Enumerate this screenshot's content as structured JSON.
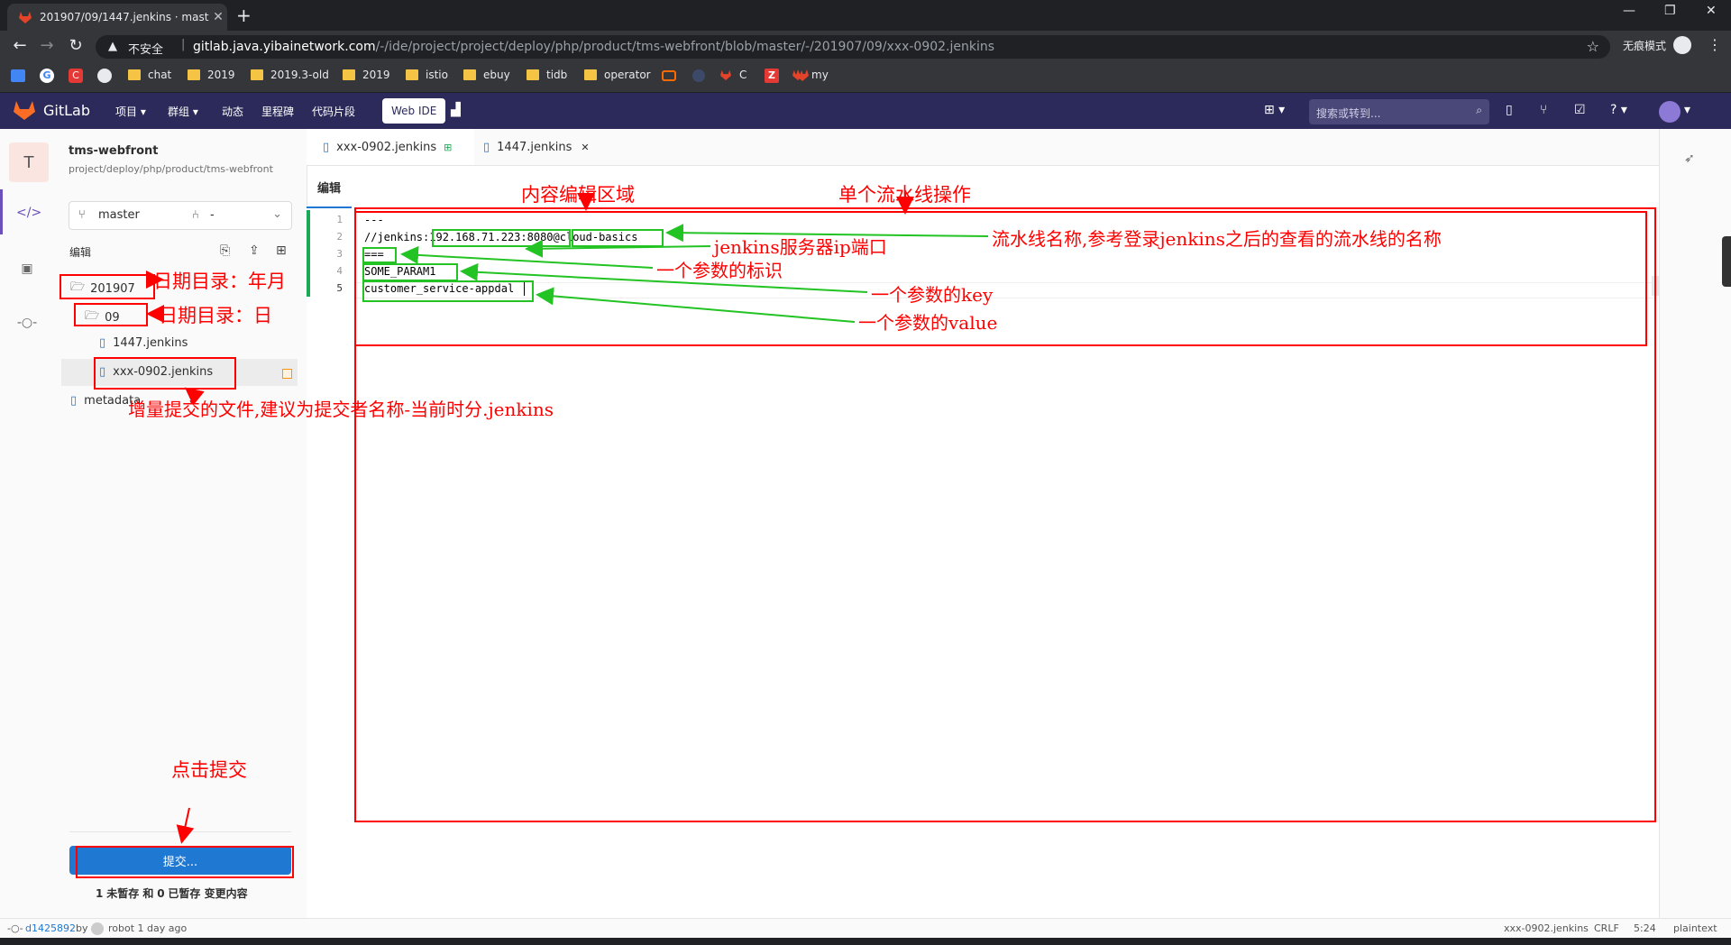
{
  "browser": {
    "tab_title": "201907/09/1447.jenkins · mast",
    "not_secure": "不安全",
    "url_host": "gitlab.java.yibainetwork.com",
    "url_path": "/-/ide/project/project/deploy/php/product/tms-webfront/blob/master/-/201907/09/xxx-0902.jenkins",
    "incognito": "无痕模式",
    "bookmarks": [
      "chat",
      "2019",
      "2019.3-old",
      "2019",
      "istio",
      "ebuy",
      "tidb",
      "operator",
      "C",
      "my"
    ]
  },
  "gitlab": {
    "brand": "GitLab",
    "nav": [
      "项目",
      "群组",
      "动态",
      "里程碑",
      "代码片段"
    ],
    "web_ide": "Web IDE",
    "search_placeholder": "搜索或转到..."
  },
  "project": {
    "avatar_letter": "T",
    "name": "tms-webfront",
    "path": "project/deploy/php/product/tms-webfront",
    "branch": "master",
    "mr": "-",
    "edit_label": "编辑"
  },
  "tree": {
    "folder1": "201907",
    "folder2": "09",
    "file1": "1447.jenkins",
    "file2": "xxx-0902.jenkins",
    "file3": "metadata"
  },
  "tabs": {
    "tab1": "xxx-0902.jenkins",
    "tab2": "1447.jenkins",
    "mode": "编辑"
  },
  "code": {
    "lines": [
      "---",
      "//jenkins:192.168.71.223:8080@cloud-basics",
      "===",
      "SOME_PARAM1",
      "customer_service-appdal"
    ],
    "numbers": [
      "1",
      "2",
      "3",
      "4",
      "5"
    ]
  },
  "commit": {
    "button": "提交...",
    "summary_a": "1",
    "summary_b": "未暂存 和",
    "summary_c": "0",
    "summary_d": "已暂存 变更内容"
  },
  "status": {
    "commit_hash": "d1425892",
    "by": "by",
    "author": "robot 1 day ago",
    "file": "xxx-0902.jenkins",
    "eol": "CRLF",
    "pos": "5:24",
    "lang": "plaintext"
  },
  "annotations": {
    "editor_area": "内容编辑区域",
    "pipeline_op": "单个流水线操作",
    "pipeline_name": "流水线名称,参考登录jenkins之后的查看的流水线的名称",
    "jenkins_ip": "jenkins服务器ip端口",
    "param_marker": "一个参数的标识",
    "param_key": "一个参数的key",
    "param_value": "一个参数的value",
    "date_ym": "日期目录：年月",
    "date_d": "日期目录：日",
    "incr_file": "增量提交的文件,建议为提交者名称-当前时分.jenkins",
    "click_commit": "点击提交"
  }
}
